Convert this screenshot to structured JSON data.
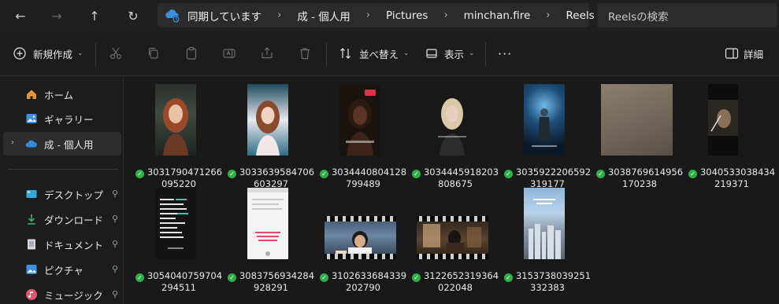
{
  "nav": {
    "back": "←",
    "forward": "→",
    "up": "↑",
    "refresh": "↻"
  },
  "address": {
    "crumbs": [
      "同期しています",
      "成 - 個人用",
      "Pictures",
      "minchan.fire",
      "Reels"
    ],
    "separator": "›"
  },
  "search": {
    "placeholder": "Reelsの検索"
  },
  "toolbar": {
    "new_label": "新規作成",
    "sort_label": "並べ替え",
    "view_label": "表示",
    "more_label": "···",
    "details_label": "詳細"
  },
  "sidebar": {
    "items": [
      {
        "label": "ホーム",
        "icon": "home-icon"
      },
      {
        "label": "ギャラリー",
        "icon": "gallery-icon"
      },
      {
        "label": "成 - 個人用",
        "icon": "onedrive-icon"
      },
      {
        "label": "デスクトップ",
        "icon": "desktop-icon"
      },
      {
        "label": "ダウンロード",
        "icon": "download-icon"
      },
      {
        "label": "ドキュメント",
        "icon": "documents-icon"
      },
      {
        "label": "ピクチャ",
        "icon": "pictures-icon"
      },
      {
        "label": "ミュージック",
        "icon": "music-icon"
      }
    ],
    "pin_glyph": "📌"
  },
  "files": [
    {
      "line1": "3031790471266",
      "line2": "095220"
    },
    {
      "line1": "3033639584706",
      "line2": "603297"
    },
    {
      "line1": "3034440804128",
      "line2": "799489"
    },
    {
      "line1": "3034445918203",
      "line2": "808675"
    },
    {
      "line1": "3035922206592",
      "line2": "319177"
    },
    {
      "line1": "3038769614956",
      "line2": "170238"
    },
    {
      "line1": "3040533038434",
      "line2": "219371"
    },
    {
      "line1": "3054040759704",
      "line2": "294511"
    },
    {
      "line1": "3083756934284",
      "line2": "928291"
    },
    {
      "line1": "3102633684339",
      "line2": "202790"
    },
    {
      "line1": "3122652319364",
      "line2": "022048"
    },
    {
      "line1": "3153738039251",
      "line2": "332383"
    }
  ],
  "status_glyph": "✓",
  "colors": {
    "accent": "#4aa3ff",
    "sync_ok": "#2fae4a",
    "window_bg": "#1c1c1c"
  }
}
